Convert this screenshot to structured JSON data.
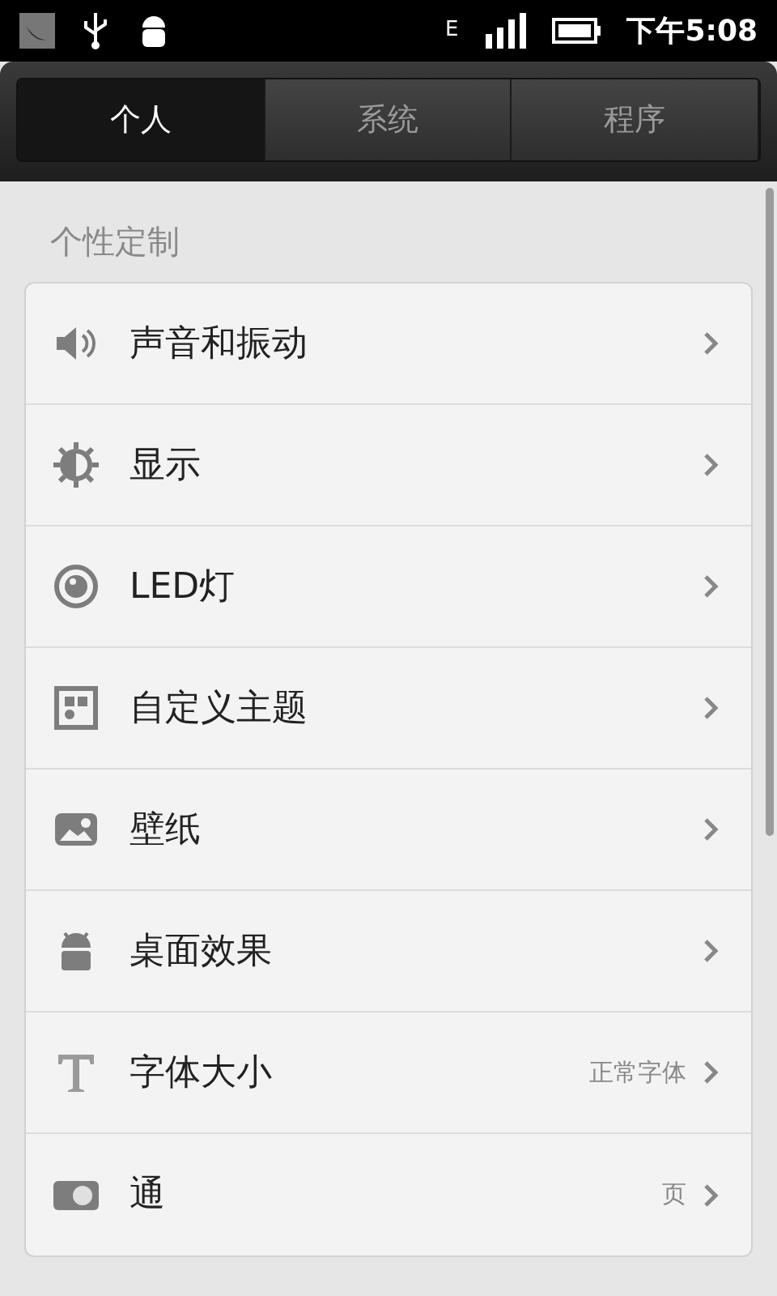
{
  "status_bar": {
    "network": "E",
    "time": "下午5:08"
  },
  "tabs": [
    {
      "label": "个人",
      "selected": true
    },
    {
      "label": "系统",
      "selected": false
    },
    {
      "label": "程序",
      "selected": false
    }
  ],
  "section": {
    "title": "个性定制"
  },
  "items": [
    {
      "label": "声音和振动"
    },
    {
      "label": "显示"
    },
    {
      "label": "LED灯"
    },
    {
      "label": "自定义主题"
    },
    {
      "label": "壁纸"
    },
    {
      "label": "桌面效果"
    },
    {
      "label": "字体大小",
      "value": "正常字体"
    },
    {
      "label": "通",
      "value": "页"
    }
  ]
}
